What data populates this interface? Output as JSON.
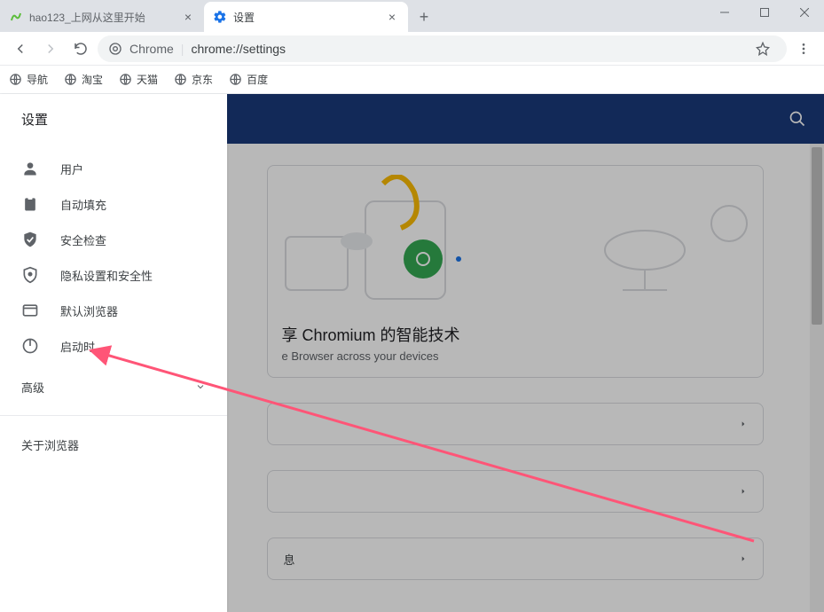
{
  "tabs": [
    {
      "title": "hao123_上网从这里开始",
      "active": false
    },
    {
      "title": "设置",
      "active": true
    }
  ],
  "omnibox": {
    "label": "Chrome",
    "url": "chrome://settings"
  },
  "bookmarks": [
    "导航",
    "淘宝",
    "天猫",
    "京东",
    "百度"
  ],
  "sidebar": {
    "header": "设置",
    "items": [
      {
        "label": "用户"
      },
      {
        "label": "自动填充"
      },
      {
        "label": "安全检查"
      },
      {
        "label": "隐私设置和安全性"
      },
      {
        "label": "默认浏览器"
      },
      {
        "label": "启动时"
      }
    ],
    "advanced": "高级",
    "about": "关于浏览器"
  },
  "content": {
    "sync_title_partial": "享 Chromium 的智能技术",
    "sync_sub_partial": "e Browser across your devices",
    "info_label": "息"
  },
  "annotation": {
    "arrow_color": "#ff5577"
  }
}
